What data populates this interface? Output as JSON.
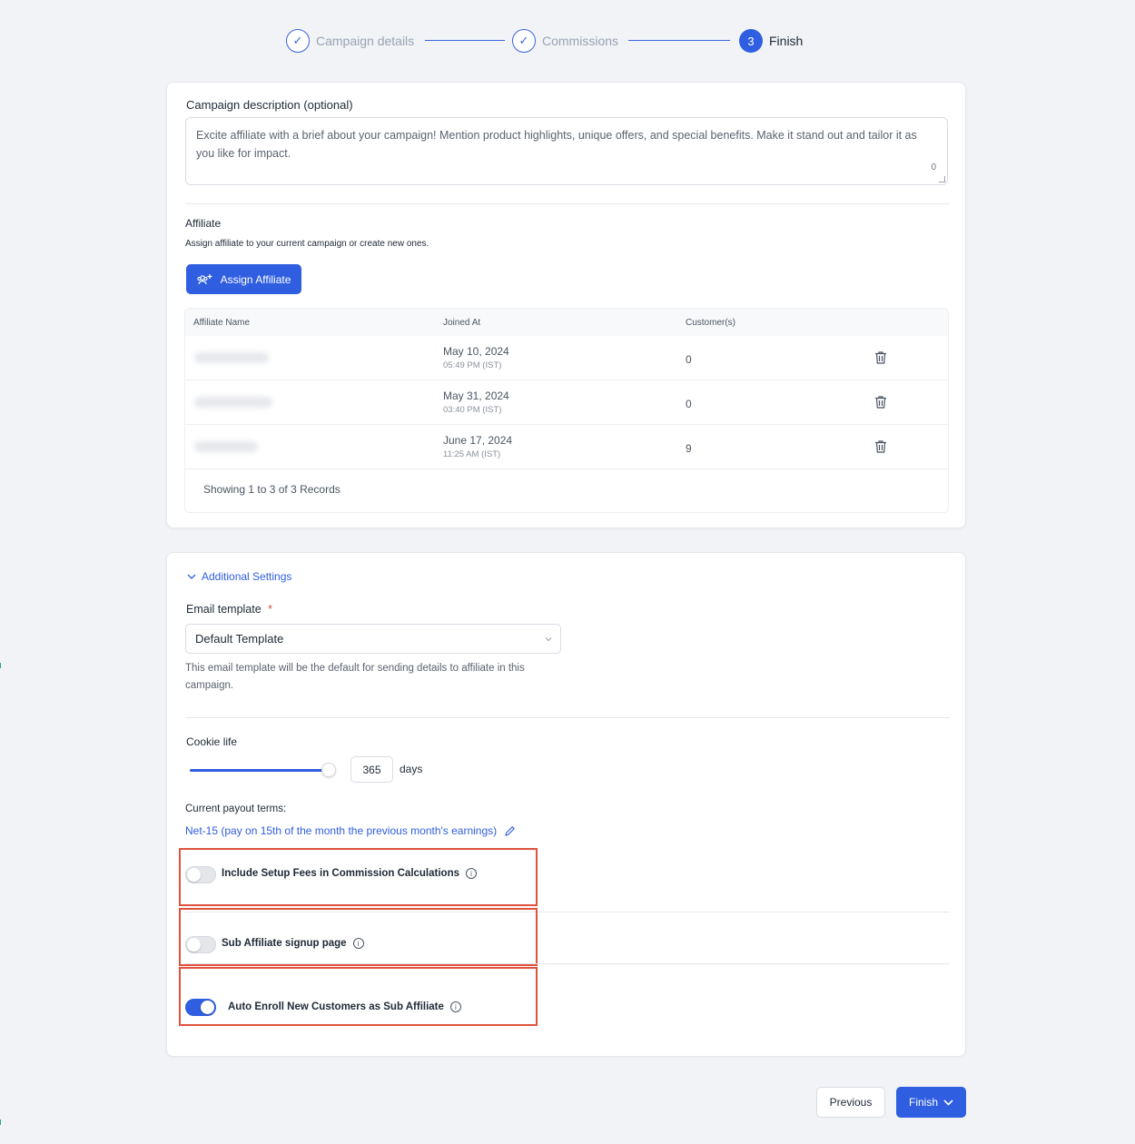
{
  "stepper": {
    "steps": [
      {
        "label": "Campaign details",
        "marker": "✓",
        "state": "done"
      },
      {
        "label": "Commissions",
        "marker": "✓",
        "state": "done"
      },
      {
        "label": "Finish",
        "marker": "3",
        "state": "active"
      }
    ]
  },
  "campaign": {
    "description_label": "Campaign description (optional)",
    "description_placeholder": "Excite affiliate with a brief about your campaign! Mention product highlights, unique offers, and special benefits. Make it stand out and tailor it as you like for impact.",
    "description_count": "0"
  },
  "affiliate": {
    "title": "Affiliate",
    "subtitle": "Assign affiliate to your current campaign or create new ones.",
    "assign_button": "Assign Affiliate",
    "columns": [
      "Affiliate Name",
      "Joined At",
      "Customer(s)"
    ],
    "rows": [
      {
        "name": "",
        "date": "May 10, 2024",
        "time": "05:49 PM (IST)",
        "customers": "0"
      },
      {
        "name": "",
        "date": "May 31, 2024",
        "time": "03:40 PM (IST)",
        "customers": "0"
      },
      {
        "name": "",
        "date": "June 17, 2024",
        "time": "11:25 AM (IST)",
        "customers": "9"
      }
    ],
    "records_text": "Showing 1 to 3 of 3 Records"
  },
  "settings": {
    "accordion_label": "Additional Settings",
    "email_template_label": "Email template",
    "required_mark": "*",
    "email_template_value": "Default Template",
    "email_template_help": "This email template will be the default for sending details to affiliate in this campaign.",
    "cookie_life_label": "Cookie life",
    "cookie_life_value": "365",
    "cookie_life_unit": "days",
    "cookie_life_fraction": 0.9,
    "payout_label": "Current payout terms:",
    "payout_value": "Net-15 (pay on 15th of the month the previous month's earnings)",
    "toggles": [
      {
        "label": "Include Setup Fees in Commission Calculations",
        "on": false
      },
      {
        "label": "Sub Affiliate signup page",
        "on": false
      },
      {
        "label": "Auto Enroll New Customers as Sub Affiliate",
        "on": true
      }
    ]
  },
  "footer": {
    "previous_button": "Previous",
    "finish_button": "Finish"
  },
  "colors": {
    "accent": "#2f5ee0",
    "highlight": "#e0523e",
    "background": "#f1f3f7"
  }
}
